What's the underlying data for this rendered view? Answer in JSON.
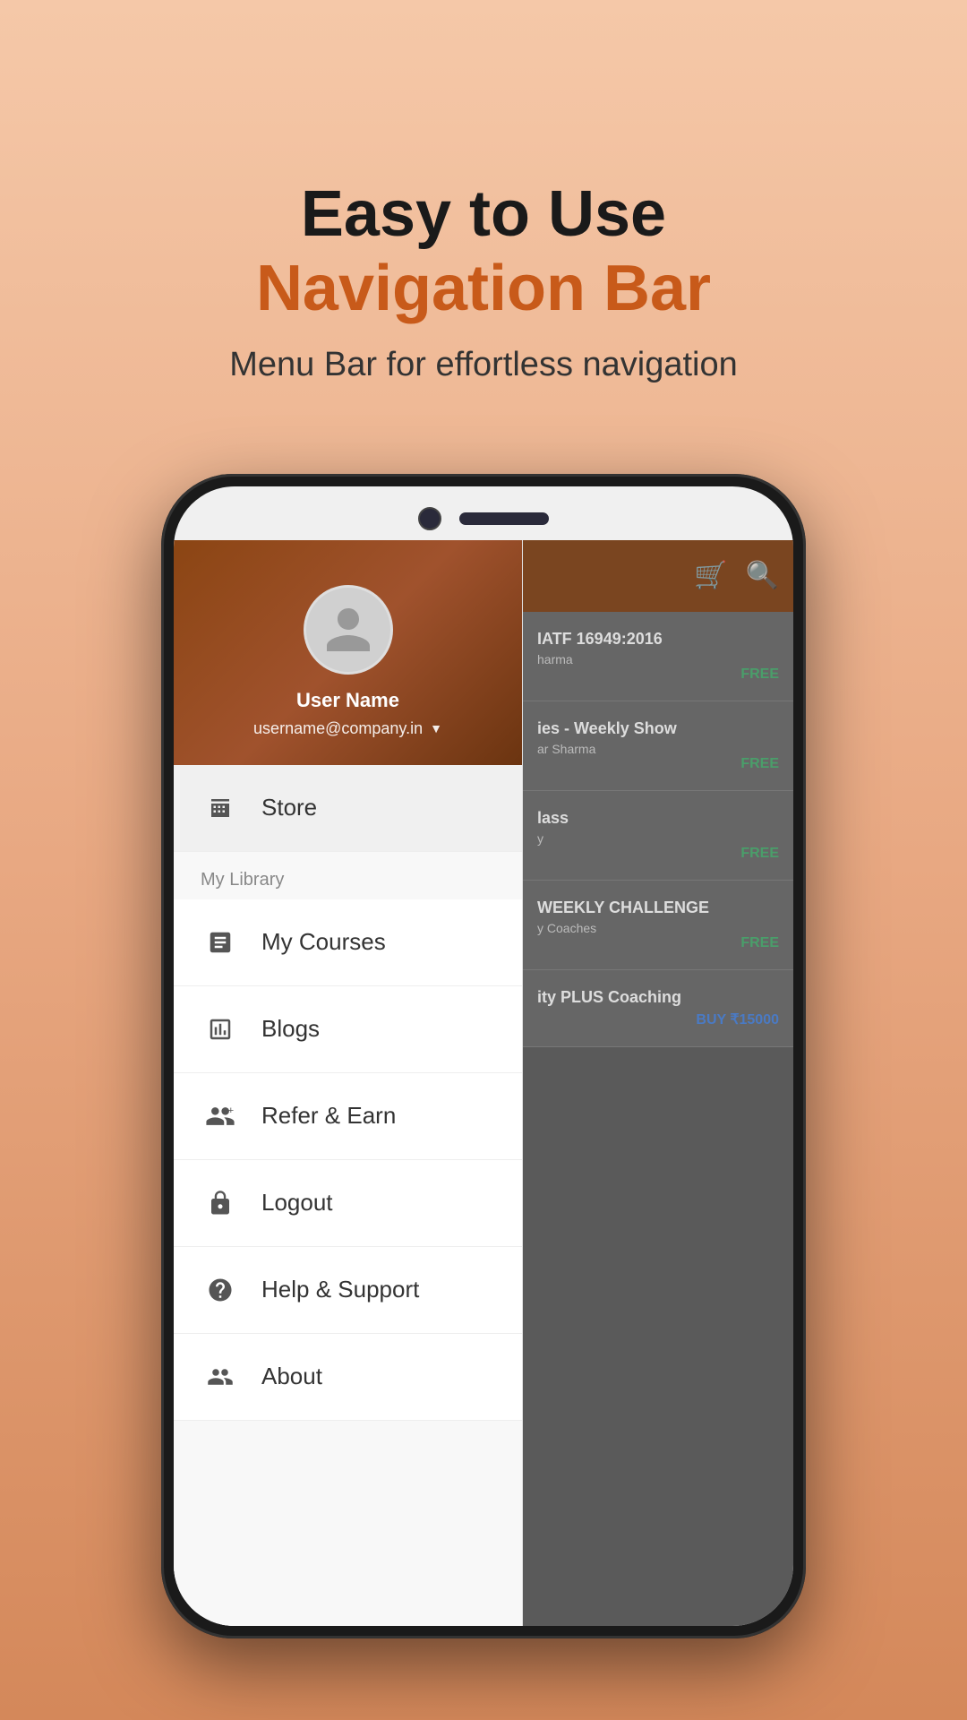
{
  "page": {
    "background_color": "#e8a882",
    "heading_line1": "Easy to Use",
    "heading_line2": "Navigation Bar",
    "subtitle": "Menu Bar for effortless navigation"
  },
  "phone": {
    "screen": {
      "drawer": {
        "user": {
          "name": "User Name",
          "email": "username@company.in"
        },
        "menu_items": [
          {
            "id": "store",
            "label": "Store",
            "icon": "store"
          },
          {
            "section": "My Library"
          },
          {
            "id": "my-courses",
            "label": "My Courses",
            "icon": "courses"
          },
          {
            "id": "blogs",
            "label": "Blogs",
            "icon": "calendar"
          },
          {
            "id": "refer-earn",
            "label": "Refer & Earn",
            "icon": "refer"
          },
          {
            "id": "logout",
            "label": "Logout",
            "icon": "lock"
          },
          {
            "id": "help-support",
            "label": "Help & Support",
            "icon": "help"
          },
          {
            "id": "about",
            "label": "About",
            "icon": "about"
          }
        ]
      },
      "right_panel": {
        "content_items": [
          {
            "title": "IATF 16949:2016",
            "sub": "harma",
            "badge": "FREE",
            "badge_type": "free"
          },
          {
            "title": "ies - Weekly Show",
            "sub": "ar Sharma",
            "badge": "FREE",
            "badge_type": "free"
          },
          {
            "title": "lass",
            "sub": "y",
            "badge": "FREE",
            "badge_type": "free"
          },
          {
            "title": "WEEKLY CHALLENGE",
            "sub": "y Coaches",
            "badge": "FREE",
            "badge_type": "free"
          },
          {
            "title": "ity PLUS Coaching",
            "sub": "",
            "badge": "BUY ₹15000",
            "badge_type": "buy"
          }
        ]
      }
    }
  }
}
